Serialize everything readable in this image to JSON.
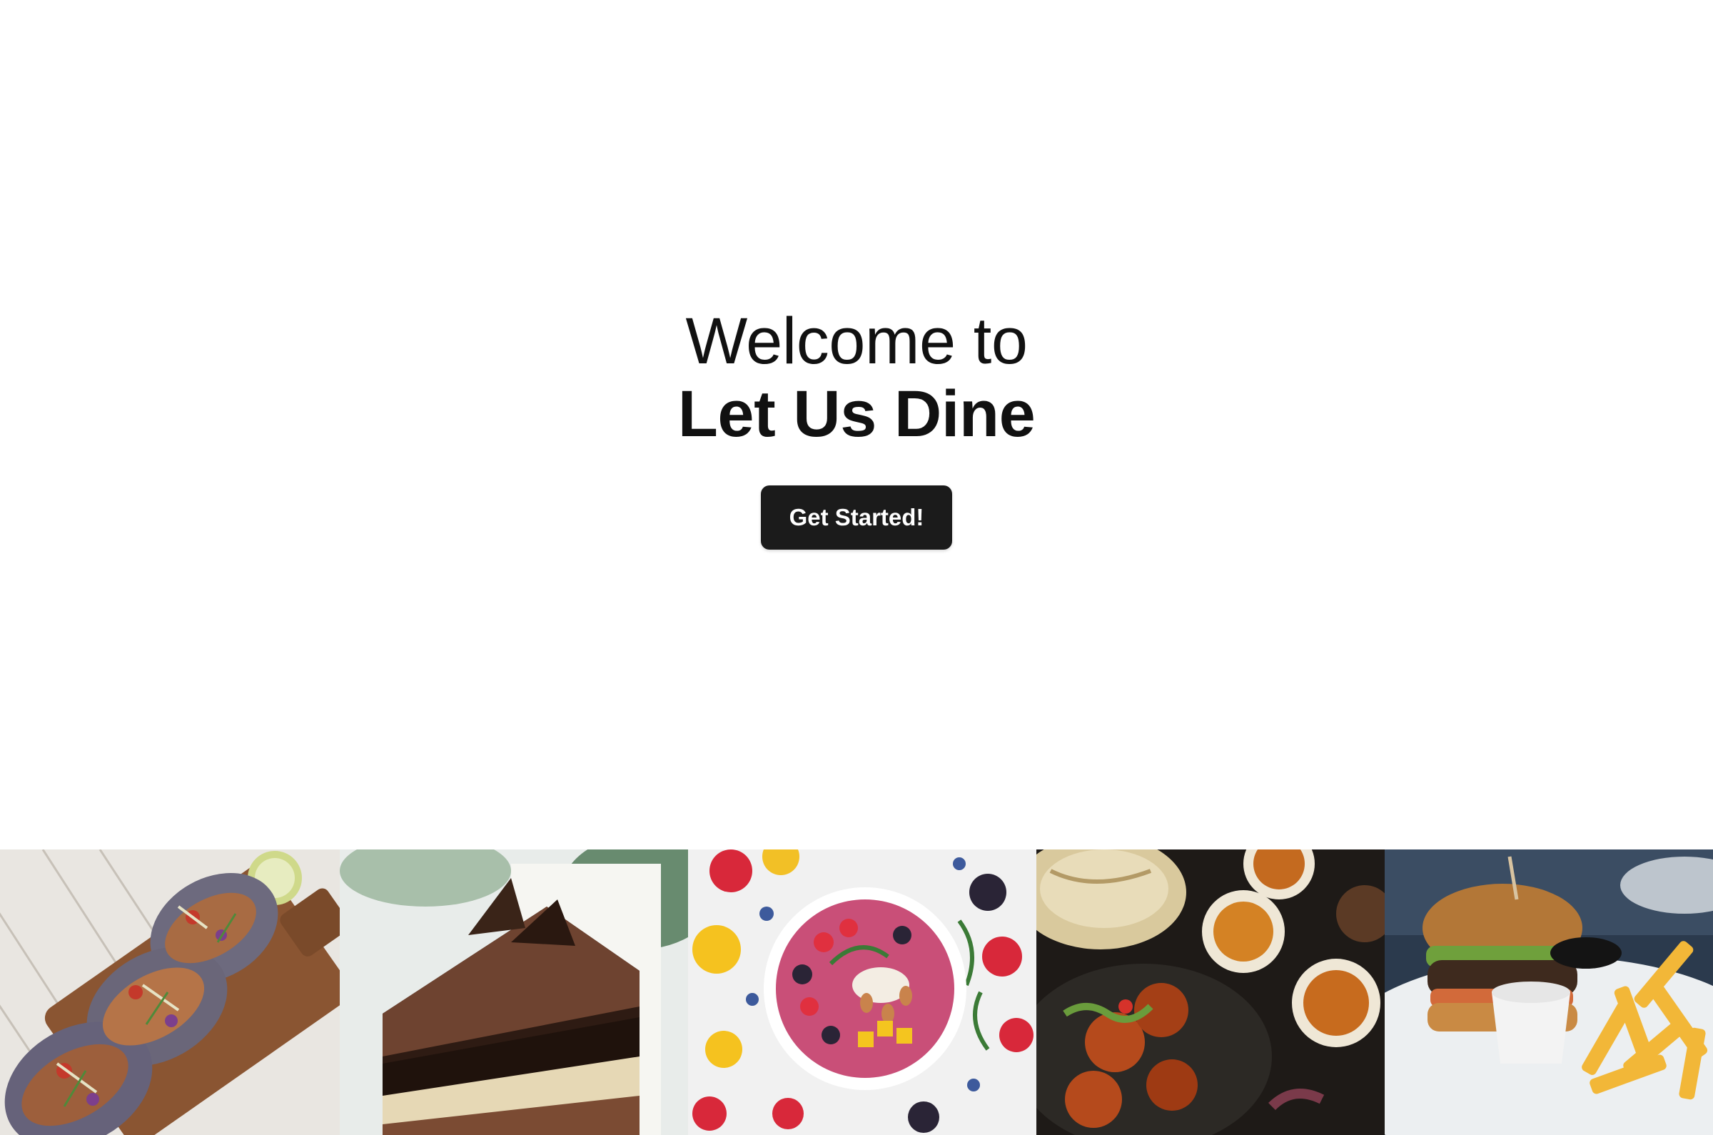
{
  "hero": {
    "welcome": "Welcome to",
    "brand": "Let Us Dine",
    "cta_label": "Get Started!"
  },
  "gallery": {
    "items": [
      {
        "name": "tacos-photo"
      },
      {
        "name": "chocolate-cake-photo"
      },
      {
        "name": "fruit-bowl-photo"
      },
      {
        "name": "indian-curry-photo"
      },
      {
        "name": "burger-fries-photo"
      }
    ]
  },
  "colors": {
    "background": "#ffffff",
    "text": "#111111",
    "button": "#1b1b1b",
    "button_text": "#ffffff"
  }
}
